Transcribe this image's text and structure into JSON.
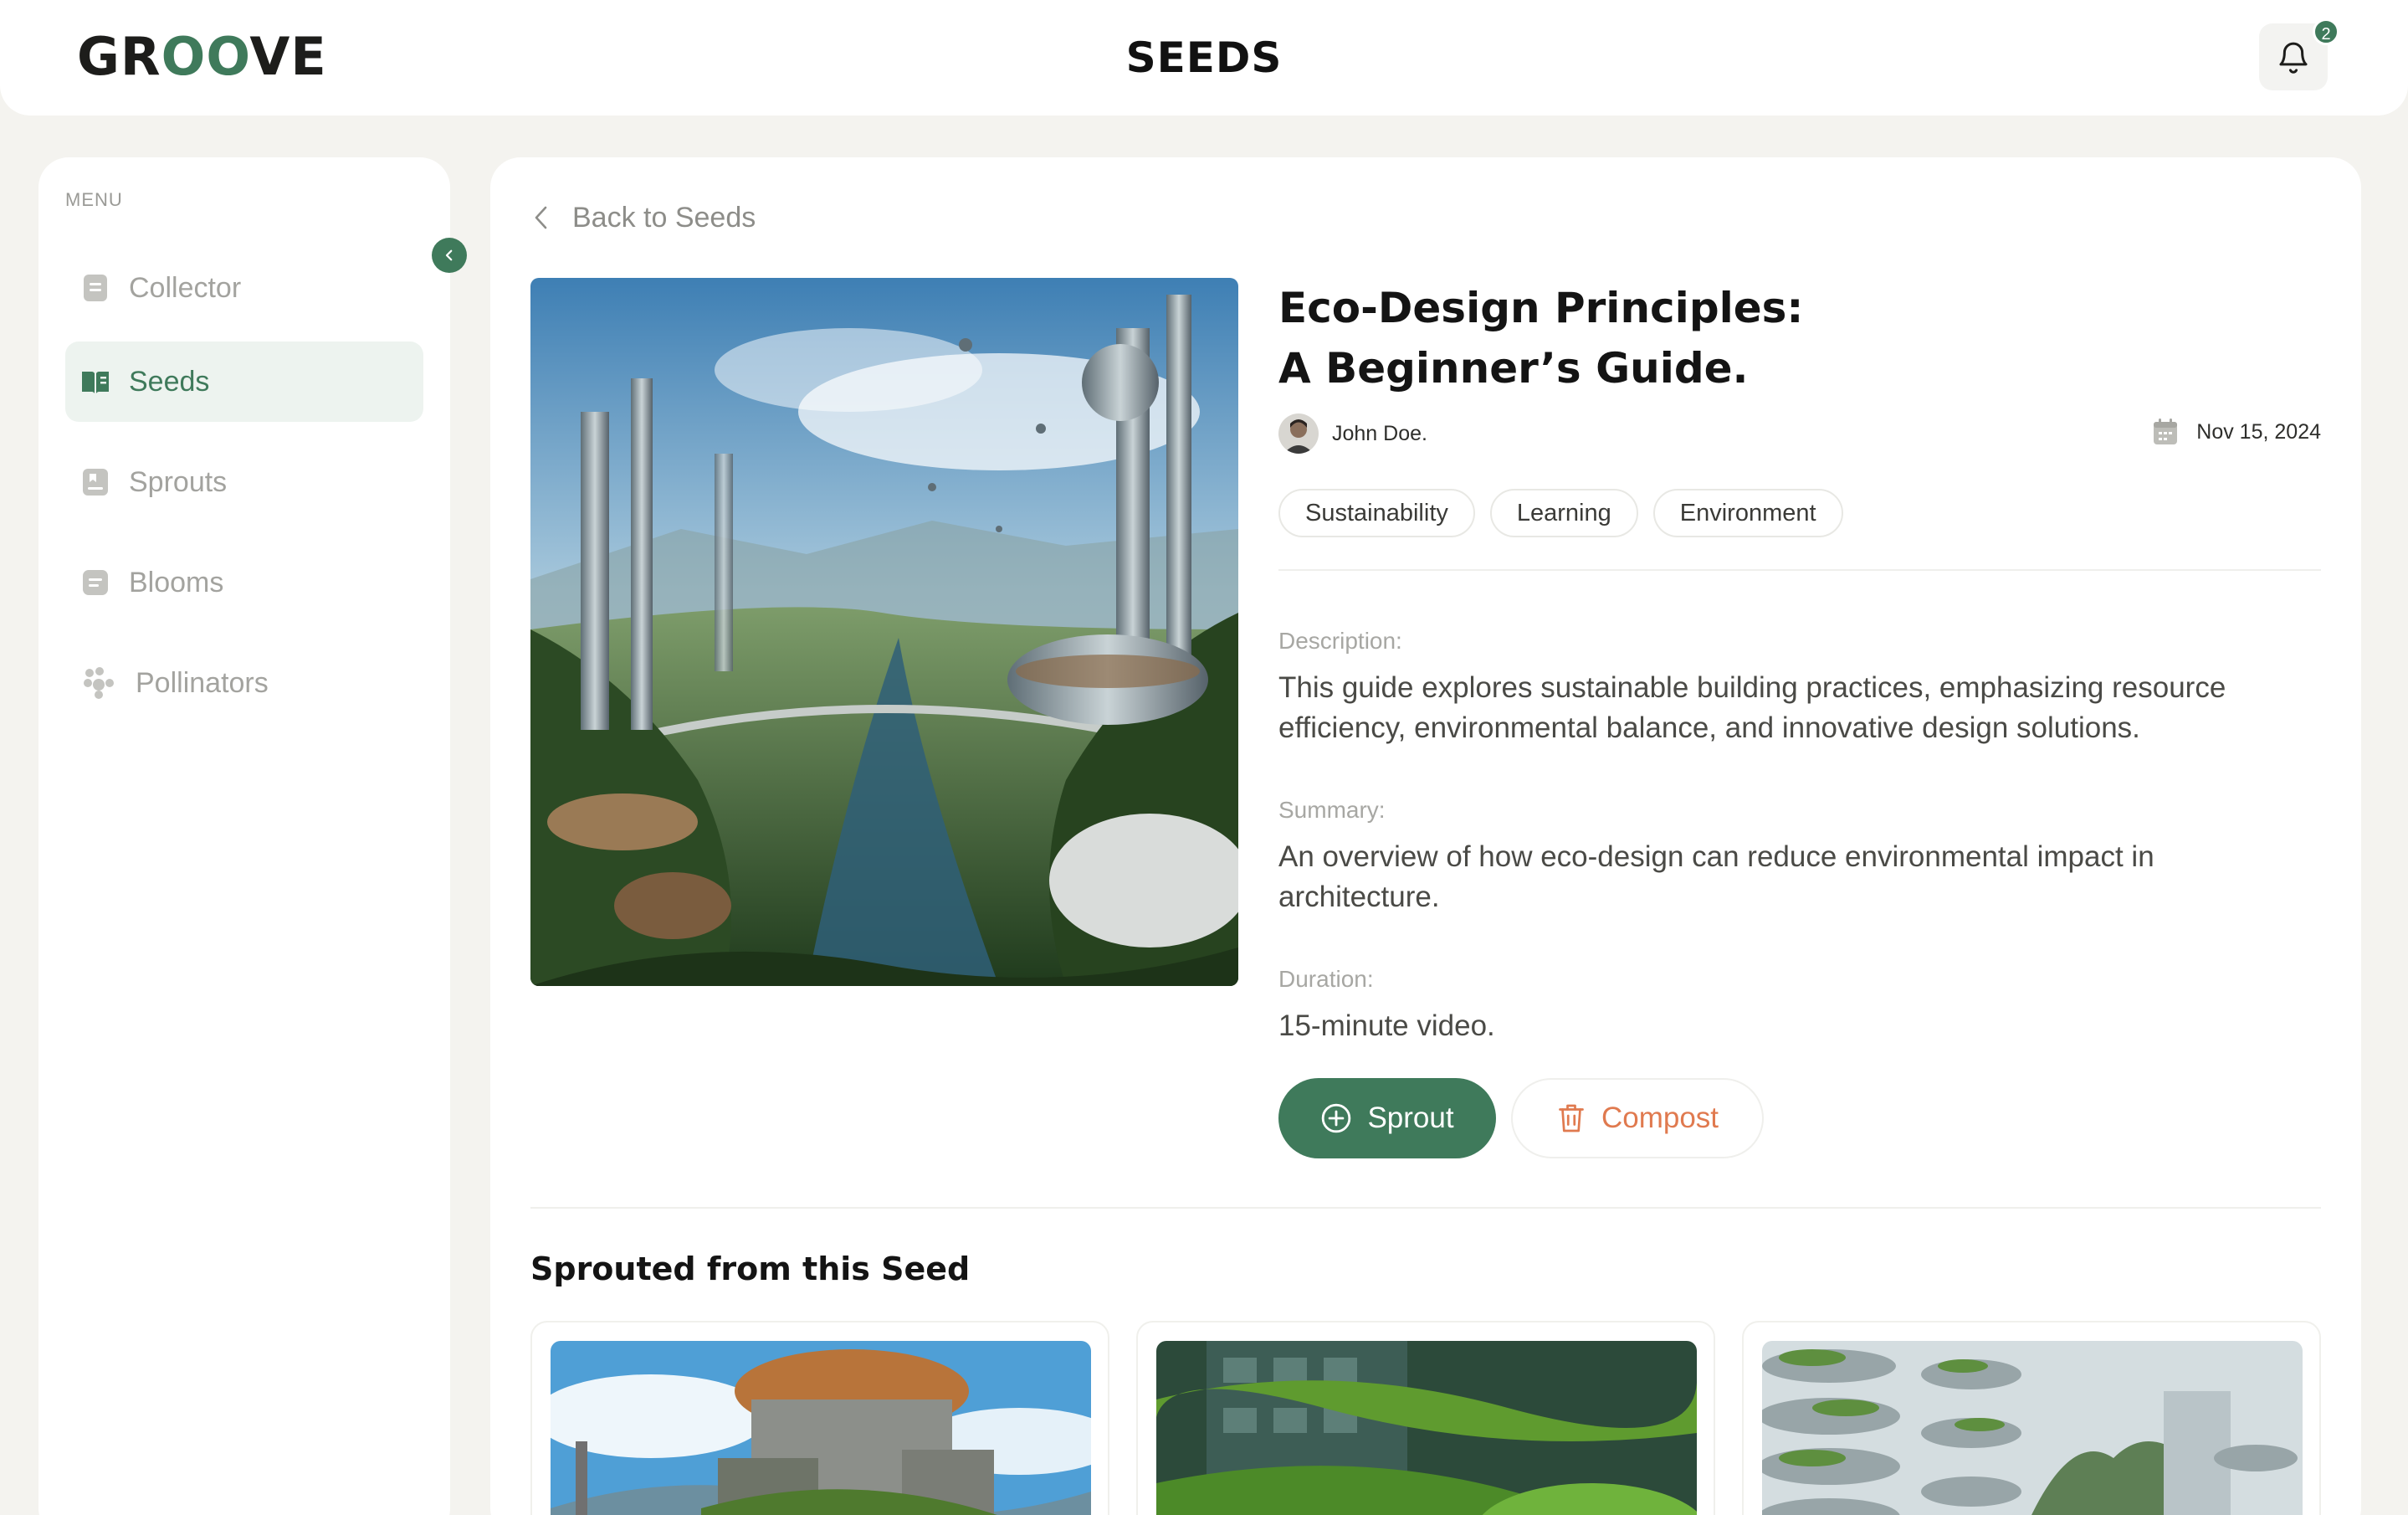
{
  "header": {
    "logo_prefix": "GR",
    "logo_oo": "OO",
    "logo_suffix": "VE",
    "page_title": "SEEDS",
    "notification_count": "2"
  },
  "sidebar": {
    "menu_title": "MENU",
    "items": [
      {
        "label": "Collector",
        "icon": "collector-icon",
        "active": false
      },
      {
        "label": "Seeds",
        "icon": "open-book-icon",
        "active": true
      },
      {
        "label": "Sprouts",
        "icon": "sprout-icon",
        "active": false
      },
      {
        "label": "Blooms",
        "icon": "bloom-icon",
        "active": false
      },
      {
        "label": "Pollinators",
        "icon": "pollinators-icon",
        "active": false
      }
    ]
  },
  "main": {
    "back_label": "Back to Seeds",
    "title_line1": "Eco-Design Principles:",
    "title_line2": "A Beginner’s Guide.",
    "author": "John Doe.",
    "date": "Nov 15, 2024",
    "tags": [
      "Sustainability",
      "Learning",
      "Environment"
    ],
    "description_label": "Description:",
    "description": "This guide explores sustainable building practices, emphasizing resource efficiency, environmental balance, and innovative design solutions.",
    "summary_label": "Summary:",
    "summary": "An overview of how eco-design can reduce environmental impact in architecture.",
    "duration_label": "Duration:",
    "duration": "15-minute video.",
    "sprout_label": "Sprout",
    "compost_label": "Compost",
    "sprouted_title": "Sprouted from this Seed"
  },
  "colors": {
    "accent": "#3f7a5b",
    "compost": "#e07a4f",
    "background": "#f4f3ef"
  }
}
